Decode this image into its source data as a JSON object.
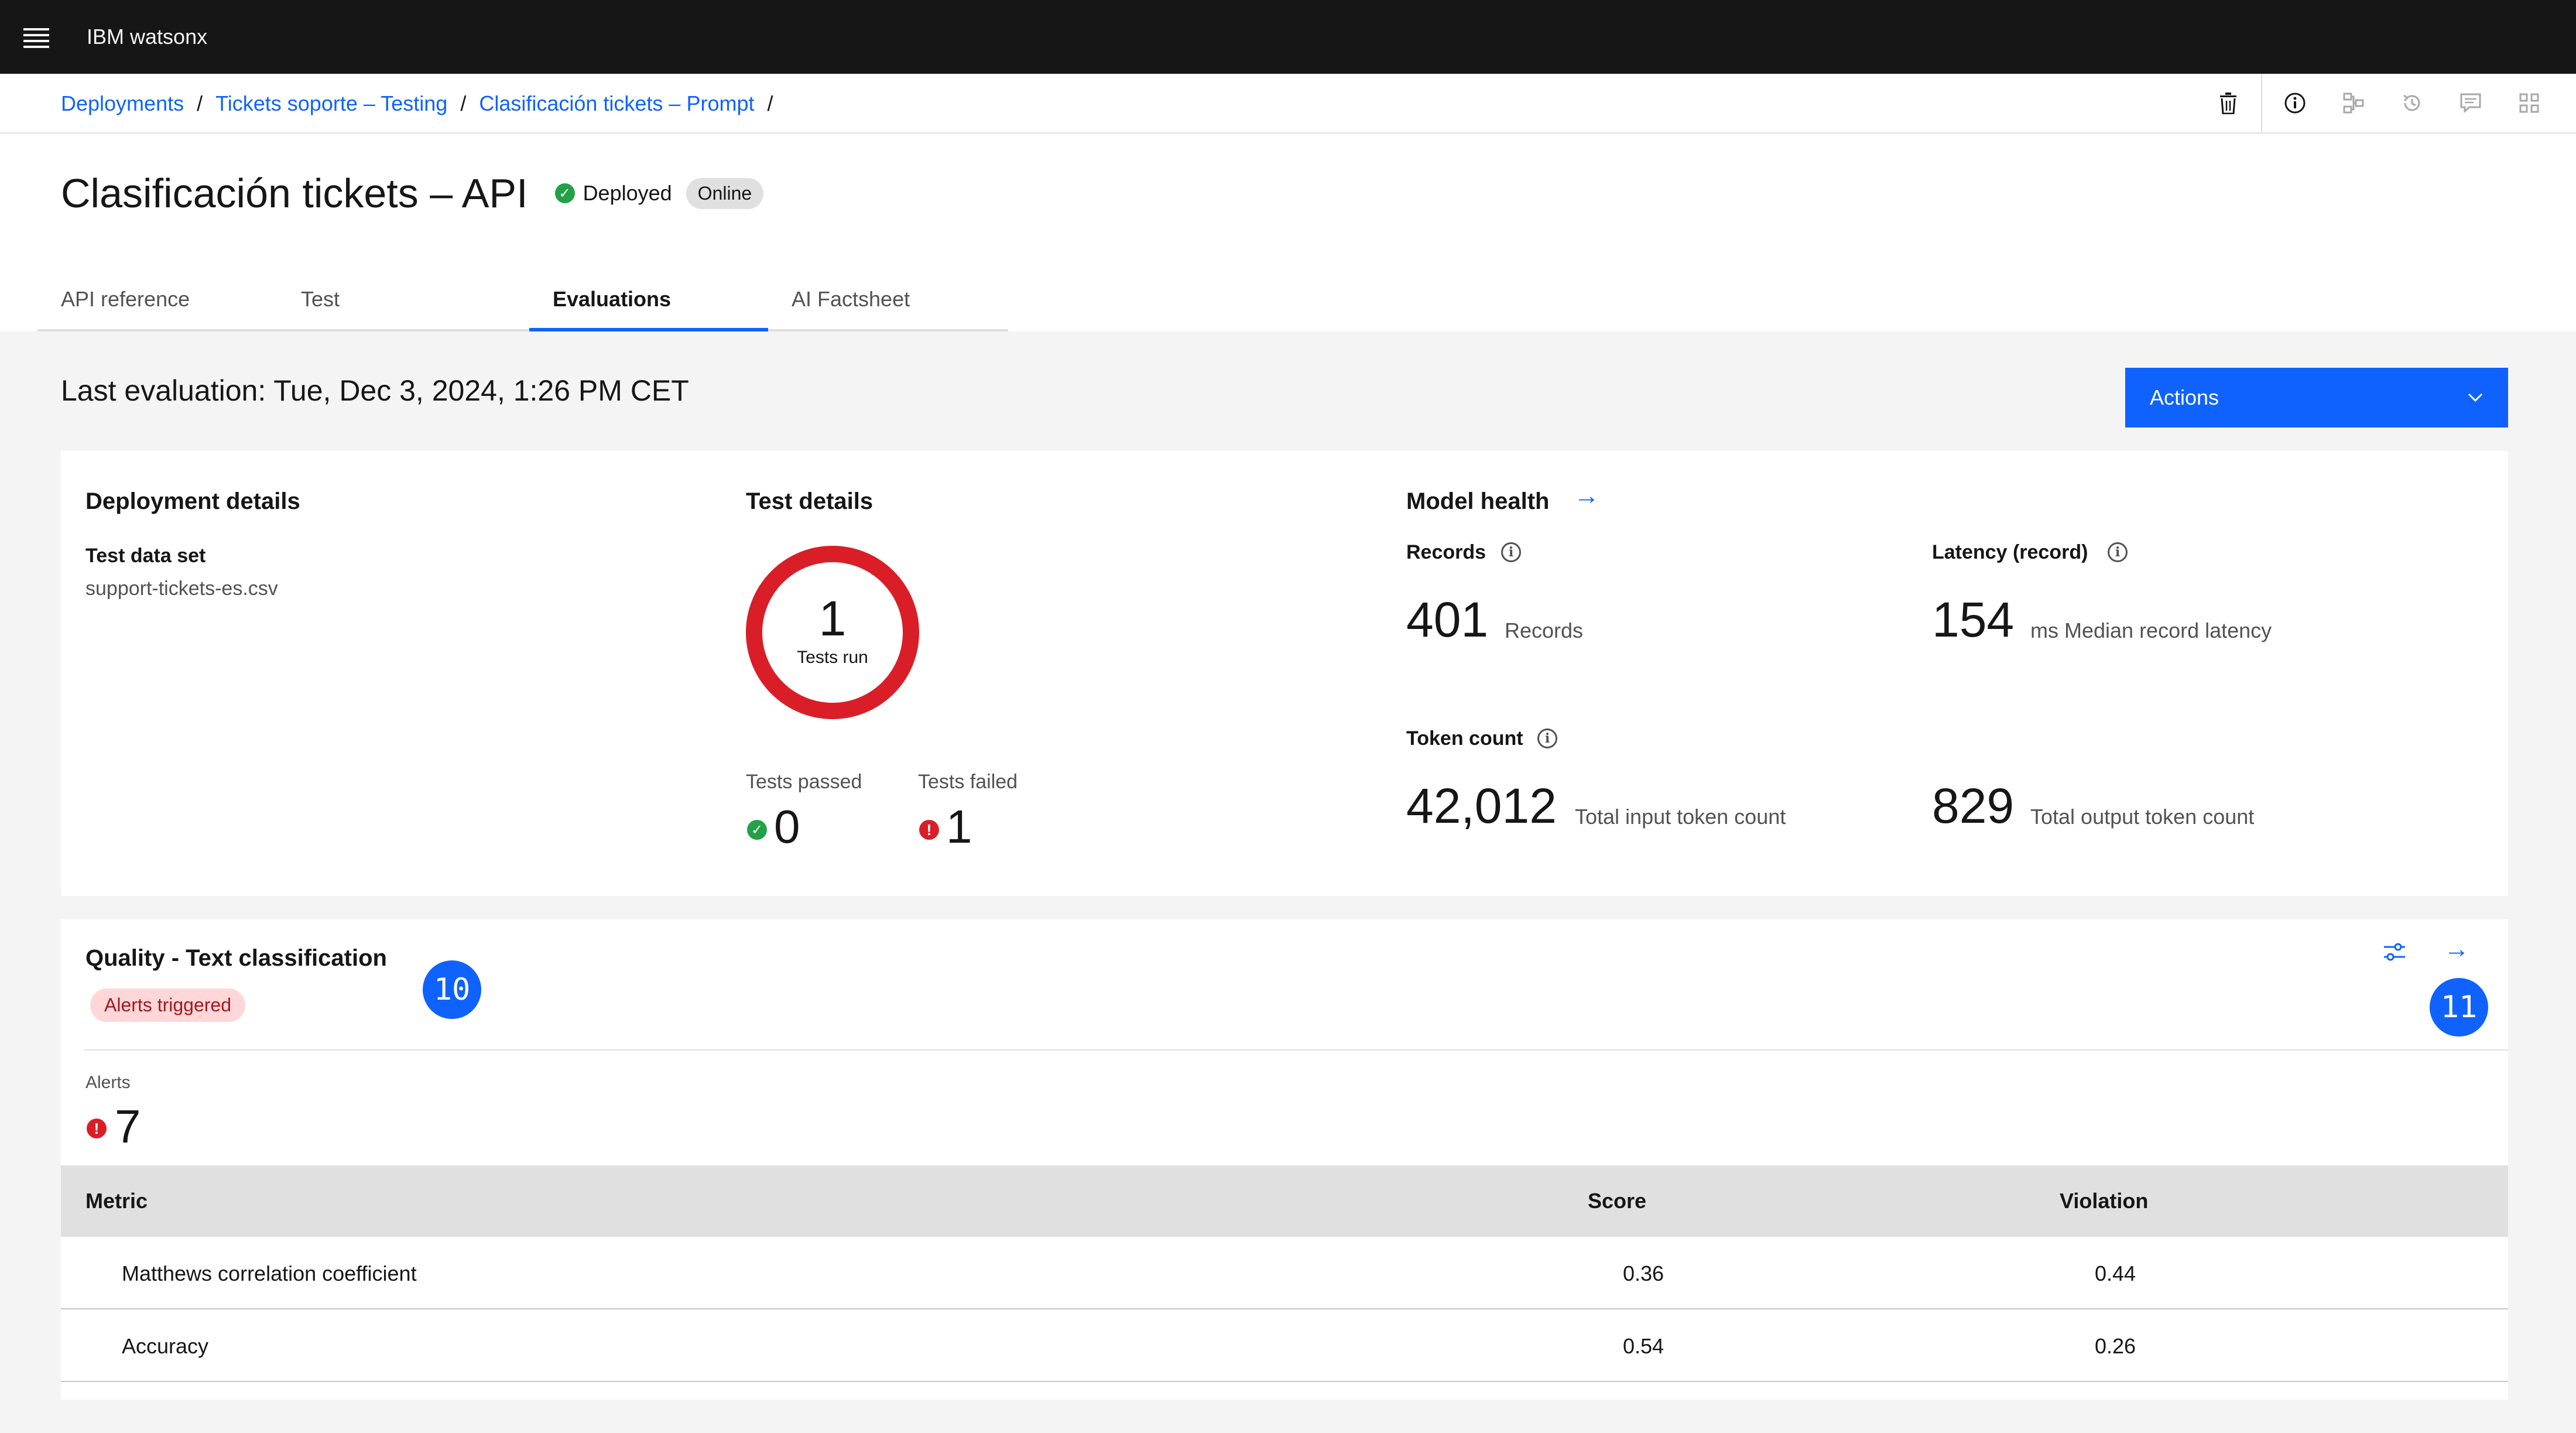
{
  "header": {
    "brand_prefix": "IBM",
    "brand_name": "watsonx"
  },
  "breadcrumb": {
    "items": [
      "Deployments",
      "Tickets soporte – Testing",
      "Clasificación tickets – Prompt"
    ],
    "separator": "/"
  },
  "toolbar": {
    "icons": [
      "trash-icon",
      "info-icon",
      "lineage-icon",
      "history-icon",
      "comment-icon",
      "apps-icon"
    ]
  },
  "page": {
    "title": "Clasificación tickets – API",
    "status_label": "Deployed",
    "status_tag": "Online"
  },
  "tabs": [
    {
      "label": "API reference"
    },
    {
      "label": "Test"
    },
    {
      "label": "Evaluations",
      "active": true
    },
    {
      "label": "AI Factsheet"
    }
  ],
  "evaluation": {
    "last_evaluation": "Last evaluation: Tue, Dec 3, 2024, 1:26 PM CET",
    "actions_label": "Actions"
  },
  "deployment_details": {
    "title": "Deployment details",
    "dataset_label": "Test data set",
    "dataset_value": "support-tickets-es.csv"
  },
  "test_details": {
    "title": "Test details",
    "tests_run": "1",
    "tests_run_label": "Tests run",
    "passed_label": "Tests passed",
    "passed_value": "0",
    "failed_label": "Tests failed",
    "failed_value": "1"
  },
  "model_health": {
    "title": "Model health",
    "records_label": "Records",
    "records_value": "401",
    "records_unit": "Records",
    "latency_label": "Latency (record)",
    "latency_value": "154",
    "latency_unit": "ms Median record latency",
    "token_label": "Token count",
    "input_tokens": "42,012",
    "input_unit": "Total input token count",
    "output_tokens": "829",
    "output_unit": "Total output token count"
  },
  "quality": {
    "title": "Quality - Text classification",
    "alert_tag": "Alerts triggered",
    "alerts_label": "Alerts",
    "alerts_value": "7",
    "callout_a": "10",
    "callout_b": "11",
    "columns": [
      "Metric",
      "Score",
      "Violation"
    ],
    "rows": [
      {
        "metric": "Matthews correlation coefficient",
        "score": "0.36",
        "violation": "0.44"
      },
      {
        "metric": "Accuracy",
        "score": "0.54",
        "violation": "0.26"
      }
    ]
  },
  "colors": {
    "accent": "#0f62fe",
    "success": "#24a148",
    "error": "#da1e28",
    "header_bg": "#161616"
  }
}
